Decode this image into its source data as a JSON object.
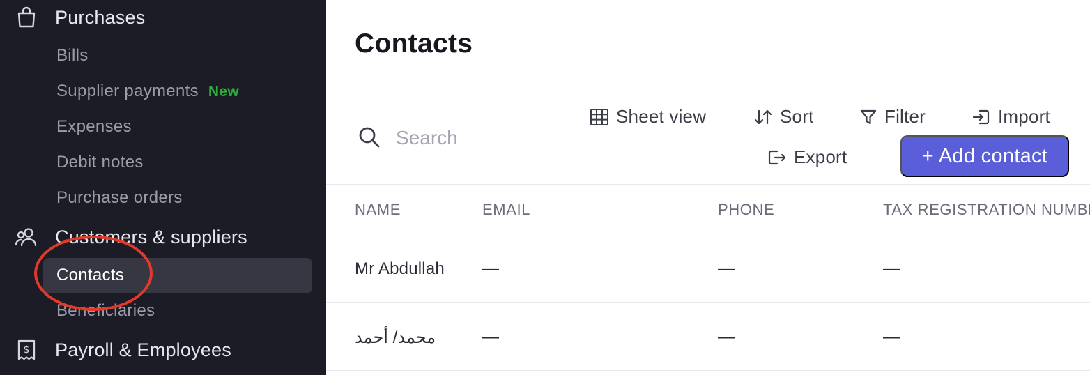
{
  "sidebar": {
    "purchases": {
      "label": "Purchases",
      "icon": "shopping-bag-icon",
      "items": [
        "Bills",
        "Supplier payments",
        "Expenses",
        "Debit notes",
        "Purchase orders"
      ],
      "new_badge": "New"
    },
    "customers_suppliers": {
      "label": "Customers & suppliers",
      "icon": "users-icon",
      "items": [
        "Contacts",
        "Beneficiaries"
      ],
      "active": "Contacts"
    },
    "payroll": {
      "label": "Payroll & Employees",
      "icon": "payroll-receipt-icon"
    }
  },
  "main": {
    "title": "Contacts",
    "search": {
      "placeholder": "Search"
    },
    "toolbar": {
      "sheet_view": "Sheet view",
      "sort": "Sort",
      "filter": "Filter",
      "import": "Import",
      "export": "Export",
      "add_contact": "+ Add contact"
    },
    "table": {
      "headers": [
        "NAME",
        "EMAIL",
        "PHONE",
        "TAX REGISTRATION NUMBER"
      ],
      "rows": [
        {
          "name": "Mr Abdullah",
          "email": "—",
          "phone": "—",
          "tax": "—"
        },
        {
          "name": "محمد/ أحمد",
          "email": "—",
          "phone": "—",
          "tax": "—"
        }
      ]
    }
  },
  "colors": {
    "sidebar_bg": "#1b1c26",
    "active_item_bg": "#363743",
    "accent": "#5a5fd9",
    "new_badge": "#2faa3c",
    "highlight_circle": "#e23a2a"
  }
}
